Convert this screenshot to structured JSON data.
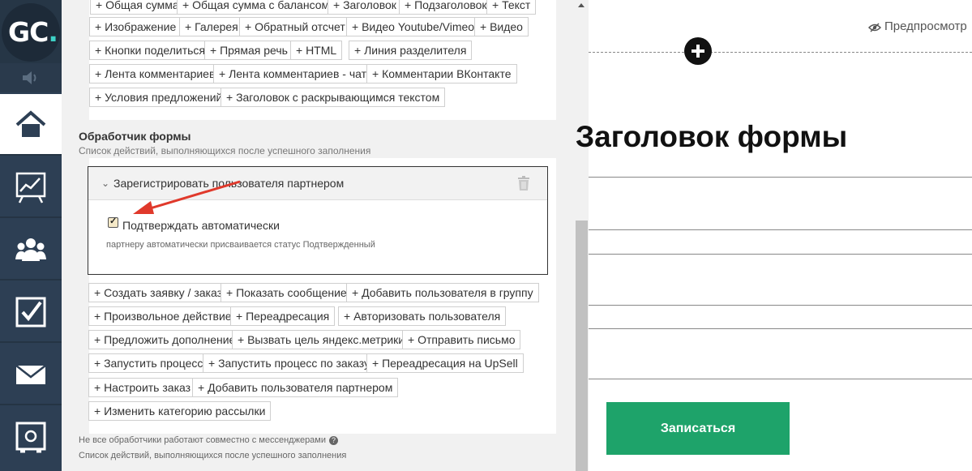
{
  "logo": {
    "text": "GC",
    "dot": "."
  },
  "nav": {
    "icons": [
      "home-icon",
      "chart-icon",
      "users-icon",
      "tasks-icon",
      "mail-icon",
      "safe-icon"
    ],
    "active": "home-icon"
  },
  "blocks": {
    "buttons": [
      "+ Общая сумма",
      "+ Общая сумма с балансом",
      "+ Заголовок",
      "+ Подзаголовок",
      "+ Текст",
      "+ Изображение",
      "+ Галерея",
      "+ Обратный отсчет",
      "+ Видео Youtube/Vimeo",
      "+ Видео",
      "+ Кнопки поделиться",
      "+ Прямая речь",
      "+ HTML",
      "+ Линия разделителя",
      "+ Лента комментариев",
      "+ Лента комментариев - чат",
      "+ Комментарии ВКонтакте",
      "+ Условия предложений",
      "+ Заголовок с раскрывающимся текстом"
    ]
  },
  "handler": {
    "title": "Обработчик формы",
    "subtitle": "Список действий, выполняющихся после успешного заполнения",
    "action": {
      "title": "Зарегистрировать пользователя партнером",
      "checkbox_label": "Подтверждать автоматически",
      "checked": true,
      "hint": "партнеру автоматически присваивается статус Подтвержденный"
    },
    "buttons": [
      "+ Создать заявку / заказ",
      "+ Показать сообщение",
      "+ Добавить пользователя в группу",
      "+ Произвольное действие",
      "+ Переадресация",
      "+ Авторизовать пользователя",
      "+ Предложить дополнение",
      "+ Вызвать цель яндекс.метрики",
      "+ Отправить письмо",
      "+ Запустить процесс",
      "+ Запустить процесс по заказу",
      "+ Переадресация на UpSell",
      "+ Настроить заказ",
      "+ Добавить пользователя партнером",
      "+ Изменить категорию рассылки"
    ],
    "footnote": "Не все обработчики работают совместно с мессенджерами",
    "footnote2": "Список действий, выполняющихся после успешного заполнения"
  },
  "preview": {
    "preview_label": "Предпросмотр",
    "heading": "Заголовок формы",
    "submit_label": "Записаться"
  },
  "colors": {
    "nav": "#2d3f54",
    "accent": "#1ea36a",
    "arrow": "#e0392b"
  }
}
